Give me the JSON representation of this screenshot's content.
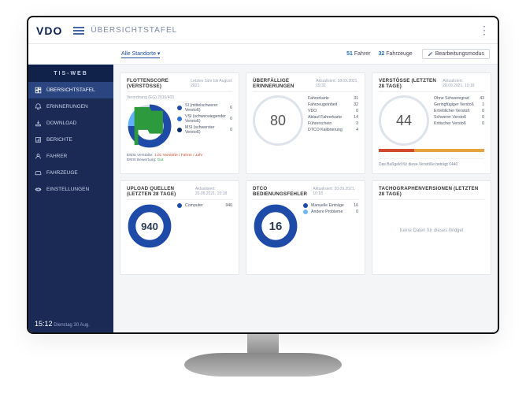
{
  "brand": "VDO",
  "page_title": "ÜBERSICHTSTAFEL",
  "location_filter": "Alle Standorte",
  "stats": {
    "drivers_count": 51,
    "drivers_label": "Fahrer",
    "vehicles_count": 32,
    "vehicles_label": "Fahrzeuge"
  },
  "edit_label": "Bearbeitungsmodus",
  "sidebar": {
    "product": "TIS-WEB",
    "items": [
      {
        "label": "ÜBERSICHTSTAFEL",
        "name": "sidebar-item-dashboard",
        "active": true
      },
      {
        "label": "ERINNERUNGEN",
        "name": "sidebar-item-reminders"
      },
      {
        "label": "DOWNLOAD",
        "name": "sidebar-item-download"
      },
      {
        "label": "BERICHTE",
        "name": "sidebar-item-reports"
      },
      {
        "label": "FAHRER",
        "name": "sidebar-item-drivers"
      },
      {
        "label": "FAHRZEUGE",
        "name": "sidebar-item-vehicles"
      },
      {
        "label": "EINSTELLUNGEN",
        "name": "sidebar-item-settings"
      }
    ],
    "clock": "15:12",
    "clock_sub": "Dienstag 30 Aug."
  },
  "cards": {
    "score": {
      "title": "FLOTTENSCORE (VERSTÖSSE)",
      "sub": "Letztes Jahr bis August 2021",
      "regulation": "Verordnung (EG) 2016/403",
      "legend": [
        {
          "label": "SI (mittelschwerer Verstoß)",
          "value": 6,
          "color": "#1f4ba8"
        },
        {
          "label": "VSI (schwerwiegender Verstoß)",
          "value": 0,
          "color": "#2b6fd6"
        },
        {
          "label": "MSI (schwerster Verstoß)",
          "value": 0,
          "color": "#0c2b66"
        }
      ],
      "foot_pre": "EMSI Verstöße: ",
      "foot_red": "1.01 Verstöße / Fahrer / Jahr",
      "foot_mid": "EMSI Bewertung: ",
      "foot_green": "Gut"
    },
    "overdue": {
      "title": "ÜBERFÄLLIGE ERINNERUNGEN",
      "updated": "Aktualisiert: 18.09.2021, 19:32",
      "center": 80,
      "rows": [
        {
          "label": "Fahrerkarte",
          "value": 31
        },
        {
          "label": "Fahrzeugeinheit",
          "value": 32
        },
        {
          "label": "VDO",
          "value": 0
        },
        {
          "label": "Ablauf Fahrerkarte",
          "value": 14
        },
        {
          "label": "Führerschein",
          "value": 3
        },
        {
          "label": "DTCO Kalibrierung",
          "value": 4
        }
      ]
    },
    "violations": {
      "title": "VERSTÖSSE (LETZTEN 28 TAGE)",
      "updated": "Aktualisiert: 20.09.2021, 10:18",
      "center": 44,
      "rows": [
        {
          "label": "Ohne Schweregrad",
          "value": 43
        },
        {
          "label": "Geringfügiger Verstoß",
          "value": 1
        },
        {
          "label": "Erheblicher Verstoß",
          "value": 0
        },
        {
          "label": "Schwerer Verstoß",
          "value": 0
        },
        {
          "label": "Kritischer Verstoß",
          "value": 0
        }
      ],
      "fine": "Das Bußgeld für diese Verstöße beträgt €440",
      "tribar": [
        "#d14a2d",
        "#e6a23c",
        "#e6a23c"
      ]
    },
    "upload": {
      "title": "UPLOAD QUELLEN (LETZTEN 28 TAGE)",
      "updated": "Aktualisiert: 20.09.2021, 10:18",
      "center": 940,
      "legend": [
        {
          "label": "Computer",
          "value": 940,
          "color": "#1f4ba8"
        }
      ]
    },
    "dtco": {
      "title": "DTCO BEDIENUNGSFEHLER",
      "updated": "Aktualisiert: 20.09.2021, 10:18",
      "center": 16,
      "legend": [
        {
          "label": "Manuelle Einträge",
          "value": 16,
          "color": "#1f4ba8"
        },
        {
          "label": "Andere Probleme",
          "value": 0,
          "color": "#6fb5ff"
        }
      ]
    },
    "tacho": {
      "title": "TACHOGRAPHENVERSIONEN (LETZTEN 28 TAGE)",
      "empty": "Keine Daten für dieses Widget"
    }
  },
  "colors": {
    "accent": "#1f4ba8",
    "ring_bg": "#dfe4ec"
  },
  "chart_data": [
    {
      "type": "pie",
      "title": "Flottenscore (Verstöße)",
      "series": [
        {
          "name": "SI",
          "value": 6
        },
        {
          "name": "VSI",
          "value": 0
        },
        {
          "name": "MSI",
          "value": 0
        }
      ]
    },
    {
      "type": "bar",
      "title": "Überfällige Erinnerungen",
      "categories": [
        "Fahrerkarte",
        "Fahrzeugeinheit",
        "VDO",
        "Ablauf Fahrerkarte",
        "Führerschein",
        "DTCO Kalibrierung"
      ],
      "values": [
        31,
        32,
        0,
        14,
        3,
        4
      ],
      "total": 80
    },
    {
      "type": "bar",
      "title": "Verstöße (letzten 28 Tage)",
      "categories": [
        "Ohne Schweregrad",
        "Geringfügiger Verstoß",
        "Erheblicher Verstoß",
        "Schwerer Verstoß",
        "Kritischer Verstoß"
      ],
      "values": [
        43,
        1,
        0,
        0,
        0
      ],
      "total": 44,
      "fine_eur": 440
    },
    {
      "type": "pie",
      "title": "Upload Quellen (letzten 28 Tage)",
      "series": [
        {
          "name": "Computer",
          "value": 940
        }
      ],
      "total": 940
    },
    {
      "type": "pie",
      "title": "DTCO Bedienungsfehler",
      "series": [
        {
          "name": "Manuelle Einträge",
          "value": 16
        },
        {
          "name": "Andere Probleme",
          "value": 0
        }
      ],
      "total": 16
    }
  ]
}
